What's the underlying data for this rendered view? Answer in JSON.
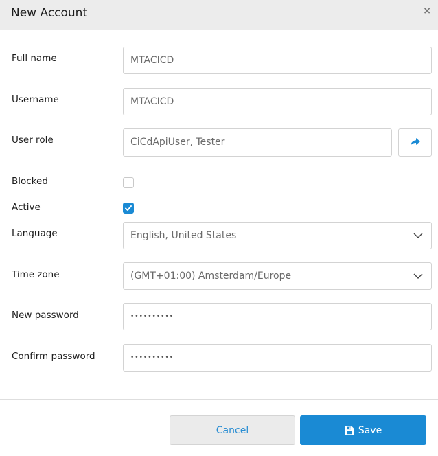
{
  "dialog": {
    "title": "New Account",
    "close_symbol": "×"
  },
  "form": {
    "full_name": {
      "label": "Full name",
      "value": "MTACICD"
    },
    "username": {
      "label": "Username",
      "value": "MTACICD"
    },
    "user_role": {
      "label": "User role",
      "value": "CiCdApiUser, Tester",
      "button_icon": "share-arrow-icon"
    },
    "blocked": {
      "label": "Blocked",
      "checked": false
    },
    "active": {
      "label": "Active",
      "checked": true
    },
    "language": {
      "label": "Language",
      "value": "English, United States"
    },
    "time_zone": {
      "label": "Time zone",
      "value": "(GMT+01:00) Amsterdam/Europe"
    },
    "new_password": {
      "label": "New password",
      "value": "••••••••••"
    },
    "confirm_password": {
      "label": "Confirm password",
      "value": "••••••••••"
    }
  },
  "footer": {
    "cancel_label": "Cancel",
    "save_label": "Save",
    "save_icon": "floppy-disk-icon"
  },
  "colors": {
    "accent": "#1a8ad4",
    "header_bg": "#ececec"
  }
}
